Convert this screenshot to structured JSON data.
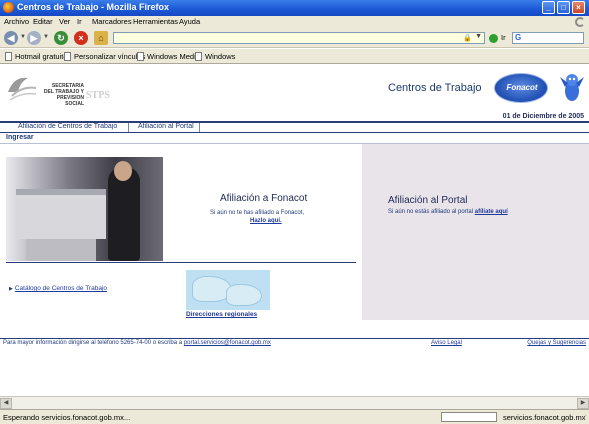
{
  "window": {
    "title": "Centros de Trabajo - Mozilla Firefox"
  },
  "menu": [
    "Archivo",
    "Editar",
    "Ver",
    "Ir",
    "Marcadores",
    "Herramientas",
    "Ayuda"
  ],
  "navbar": {
    "address_value": "",
    "go_label": "Ir",
    "search_engine": "G"
  },
  "bookmarks": [
    "Hotmail gratuito",
    "Personalizar vínculos",
    "Windows Media",
    "Windows"
  ],
  "site": {
    "agency_text": "SECRETARIA DEL TRABAJO Y PREVISION SOCIAL",
    "agency_acronym": "STPS",
    "header_title": "Centros de Trabajo",
    "brand_logo_text": "Fonacot",
    "date": "01 de Diciembre de 2005",
    "tabs": [
      "Afiliación de Centros de Trabajo",
      "Afiliación al Portal"
    ],
    "ingresar": "Ingresar",
    "afiliacion_fonacot": {
      "title": "Afiliación a Fonacot",
      "subtitle": "Si aún no te has afiliado a Fonacot,",
      "link": "Hazlo aquí."
    },
    "afiliacion_portal": {
      "title": "Afiliación al Portal",
      "subtitle": "Si aún no estás afiliado al portal",
      "link": "afíliate aquí"
    },
    "catalogo_link": "Catálogo de Centros de Trabajo",
    "direcciones_link": "Direcciones regionales",
    "footer": {
      "info_text": "Para mayor información dirigirse al teléfono 5265-74-00 o escriba a",
      "email": "portal.servicios@fonacot.gob.mx",
      "aviso": "Aviso Legal",
      "quejas": "Quejas y Sugerencias"
    }
  },
  "status": {
    "message": "Esperando servicios.fonacot.gob.mx...",
    "host": "servicios.fonacot.gob.mx"
  },
  "colors": {
    "titlebar": "#1c5ad6",
    "accent_navy": "#2a3d7a",
    "portal_panel": "#e8e4ea"
  }
}
